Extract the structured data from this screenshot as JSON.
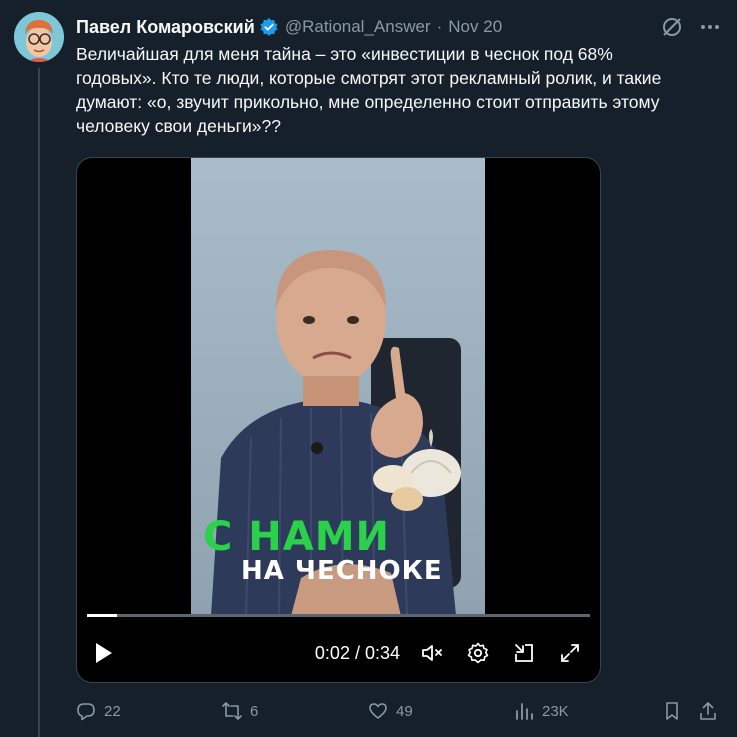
{
  "tweet": {
    "author_name": "Павел Комаровский",
    "handle": "@Rational_Answer",
    "separator": "·",
    "date": "Nov 20",
    "text": "Величайшая для меня тайна – это «инвестиции в чеснок под 68%\nгодовых». Кто те люди, которые смотрят этот рекламный ролик, и такие\nдумают: «о, звучит прикольно, мне определенно стоит отправить этому\nчеловеку свои деньги»??"
  },
  "video": {
    "caption_line1": "С НАМИ",
    "caption_line2": "НА ЧЕСНОКЕ",
    "time": "0:02 / 0:34",
    "progress_fraction": 0.059
  },
  "actions": {
    "replies": "22",
    "reposts": "6",
    "likes": "49",
    "views": "23K"
  },
  "colors": {
    "background": "#15202b",
    "accent": "#1d9bf0",
    "muted": "#8b98a5",
    "caption_green": "#2bd14a"
  },
  "icons": {
    "header": [
      "grok-icon",
      "more-icon"
    ],
    "video_controls": [
      "play-icon",
      "mute-icon",
      "settings-icon",
      "pip-icon",
      "fullscreen-icon"
    ],
    "actions": [
      "reply-icon",
      "repost-icon",
      "like-icon",
      "views-icon",
      "bookmark-icon",
      "share-icon"
    ]
  }
}
